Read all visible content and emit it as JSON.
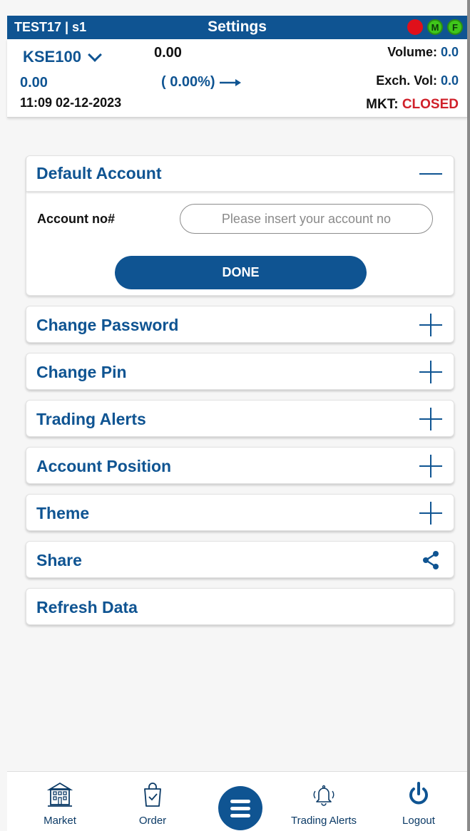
{
  "titlebar": {
    "user": "TEST17 | s1",
    "title": "Settings",
    "indicator_m": "M",
    "indicator_f": "F"
  },
  "index": {
    "name": "KSE100",
    "price": "0.00",
    "volume_label": "Volume:",
    "volume_value": "0.0",
    "change": "0.00",
    "change_pct": "( 0.00%)",
    "exch_label": "Exch. Vol:",
    "exch_value": "0.0",
    "datetime": "11:09 02-12-2023",
    "mkt_label": "MKT:",
    "mkt_status": "CLOSED"
  },
  "default_account": {
    "label": "Default Account",
    "field_label": "Account no#",
    "field_value": "",
    "placeholder": "Please insert your account no",
    "done_label": "DONE"
  },
  "sections": {
    "change_password": "Change Password",
    "change_pin": "Change Pin",
    "trading_alerts": "Trading Alerts",
    "account_position": "Account Position",
    "theme": "Theme",
    "share": "Share",
    "refresh_data": "Refresh Data"
  },
  "bottomnav": {
    "market": "Market",
    "order": "Order",
    "trading_alerts": "Trading Alerts",
    "logout": "Logout"
  },
  "colors": {
    "primary": "#0f5492",
    "closed": "#d0202a",
    "status_red": "#e0101a",
    "status_green": "#3fc61a"
  }
}
